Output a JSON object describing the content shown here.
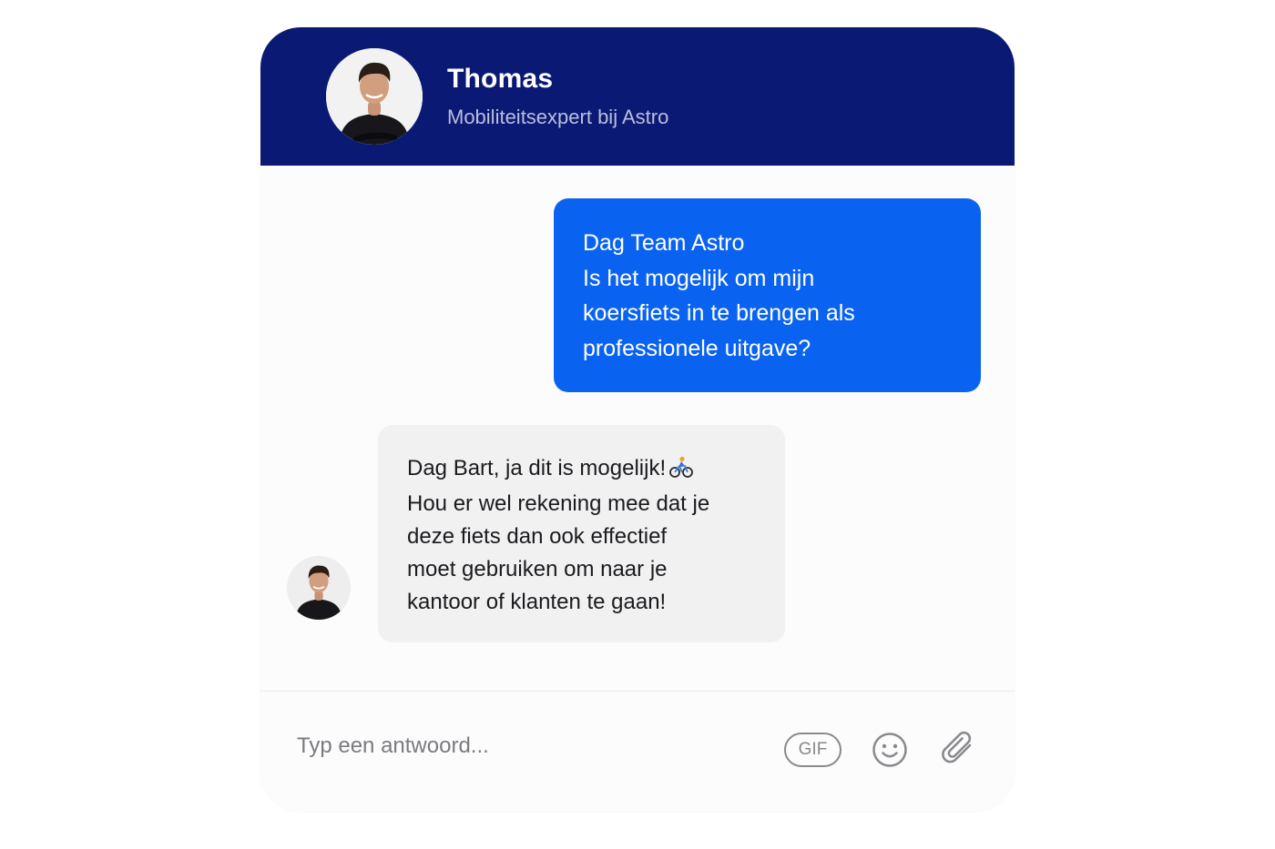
{
  "header": {
    "name": "Thomas",
    "role": "Mobiliteitsexpert bij Astro",
    "avatar_icon": "person-avatar-icon"
  },
  "messages": [
    {
      "sender": "user",
      "lines": [
        "Dag Team Astro",
        "Is het mogelijk om mijn",
        "koersfiets in te brengen als",
        "professionele uitgave?"
      ]
    },
    {
      "sender": "agent",
      "lines": [
        "Dag Bart, ja dit is mogelijk!",
        "Hou er wel rekening mee dat je",
        "deze fiets dan ook effectief",
        "moet gebruiken om naar je",
        "kantoor of klanten te gaan!"
      ],
      "emoji": "bicycle-rider-icon"
    }
  ],
  "composer": {
    "placeholder": "Typ een antwoord...",
    "gif_label": "GIF",
    "emoji_icon": "smiley-icon",
    "attach_icon": "paperclip-icon"
  },
  "colors": {
    "header_bg": "#0a1a74",
    "user_bubble": "#0a63f0",
    "agent_bubble": "#f1f1f2"
  }
}
